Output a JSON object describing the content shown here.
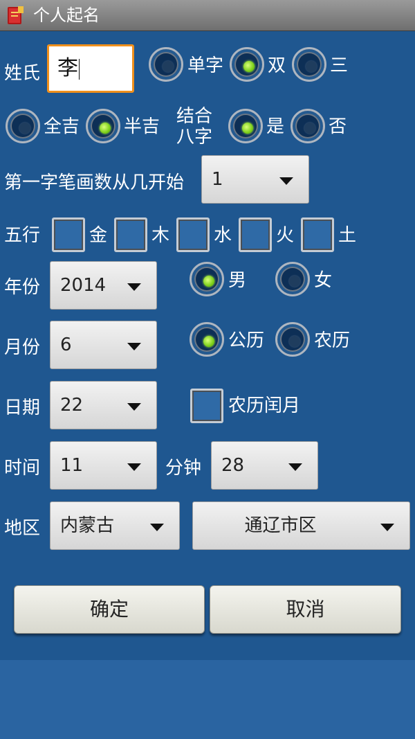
{
  "titlebar": {
    "title": "个人起名",
    "icon": "red-book-app-icon"
  },
  "surname": {
    "label": "姓氏",
    "value": "李"
  },
  "char_count": {
    "options": [
      "单字",
      "双",
      "三"
    ],
    "selected": "双"
  },
  "luck": {
    "options": [
      "全吉",
      "半吉"
    ],
    "selected": "半吉"
  },
  "bazi": {
    "label": "结合八字",
    "options": [
      "是",
      "否"
    ],
    "selected": "是"
  },
  "stroke_start": {
    "label": "第一字笔画数从几开始",
    "value": "1"
  },
  "wuxing": {
    "label": "五行",
    "items": [
      "金",
      "木",
      "水",
      "火",
      "土"
    ]
  },
  "year": {
    "label": "年份",
    "value": "2014"
  },
  "gender": {
    "options": [
      "男",
      "女"
    ],
    "selected": "男"
  },
  "month": {
    "label": "月份",
    "value": "6"
  },
  "calendar": {
    "options": [
      "公历",
      "农历"
    ],
    "selected": "公历"
  },
  "day": {
    "label": "日期",
    "value": "22"
  },
  "leap_month": {
    "label": "农历闰月"
  },
  "hour": {
    "label": "时间",
    "value": "11"
  },
  "minute": {
    "label": "分钟",
    "value": "28"
  },
  "region": {
    "label": "地区",
    "province": "内蒙古",
    "city": "通辽市区"
  },
  "buttons": {
    "confirm": "确定",
    "cancel": "取消"
  },
  "colors": {
    "background": "#26609b",
    "panel": "#1f5790",
    "focus": "#f0901c",
    "radio_on": "#7ccf1a"
  }
}
